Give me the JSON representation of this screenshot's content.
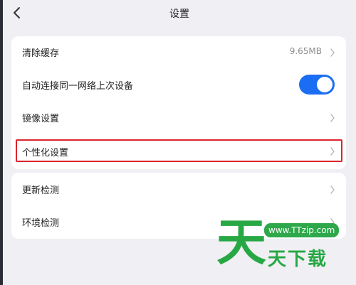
{
  "header": {
    "title": "设置",
    "back_icon": "chevron-left-icon"
  },
  "settings_group_1": {
    "clear_cache": {
      "label": "清除缓存",
      "value": "9.65MB"
    },
    "auto_connect": {
      "label": "自动连接同一网络上次设备",
      "enabled": true
    },
    "mirror_settings": {
      "label": "镜像设置"
    },
    "personalization": {
      "label": "个性化设置",
      "highlight_color": "#d9262c"
    }
  },
  "settings_group_2": {
    "update_check": {
      "label": "更新检测"
    },
    "environment_check": {
      "label": "环境检测"
    }
  },
  "watermark": {
    "url": "www.TTzip.com",
    "big_char": "天",
    "small_text": "天下载",
    "color": "#27a844"
  },
  "colors": {
    "accent": "#1b6ef3",
    "background": "#efeff4"
  }
}
